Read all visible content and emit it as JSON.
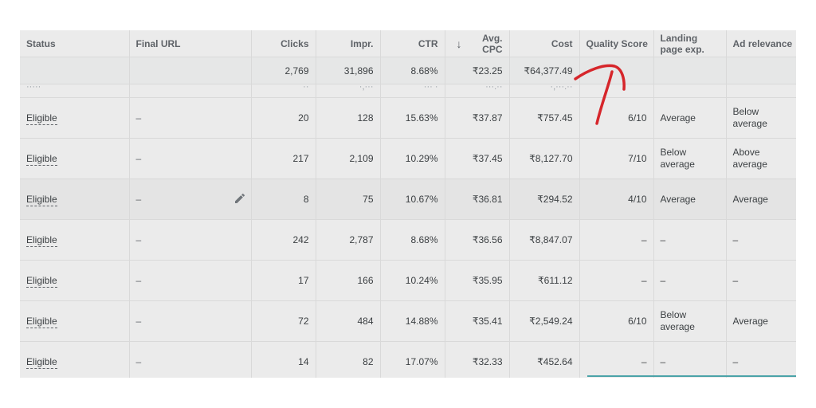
{
  "headers": {
    "status": "Status",
    "final_url": "Final URL",
    "clicks": "Clicks",
    "impr": "Impr.",
    "ctr": "CTR",
    "avg_cpc_line1": "Avg.",
    "avg_cpc_line2": "CPC",
    "cost": "Cost",
    "quality_score": "Quality Score",
    "landing_page": "Landing page exp.",
    "ad_relevance": "Ad relevance"
  },
  "sort": {
    "column": "avg_cpc",
    "direction": "descending",
    "icon": "arrow-down-icon"
  },
  "totals": {
    "clicks": "2,769",
    "impr": "31,896",
    "ctr": "8.68%",
    "avg_cpc": "₹23.25",
    "cost": "₹64,377.49"
  },
  "partial_row": {
    "status": "·····",
    "clicks": "··",
    "impr": "·,···",
    "ctr": "··· ·",
    "avg_cpc": "···.··",
    "cost": "·,···.··"
  },
  "rows": [
    {
      "status": "Eligible",
      "final_url": "–",
      "clicks": "20",
      "impr": "128",
      "ctr": "15.63%",
      "avg_cpc": "₹37.87",
      "cost": "₹757.45",
      "quality_score": "6/10",
      "landing_page": "Average",
      "ad_relevance": "Below average"
    },
    {
      "status": "Eligible",
      "final_url": "–",
      "clicks": "217",
      "impr": "2,109",
      "ctr": "10.29%",
      "avg_cpc": "₹37.45",
      "cost": "₹8,127.70",
      "quality_score": "7/10",
      "landing_page": "Below average",
      "ad_relevance": "Above average"
    },
    {
      "status": "Eligible",
      "final_url": "–",
      "clicks": "8",
      "impr": "75",
      "ctr": "10.67%",
      "avg_cpc": "₹36.81",
      "cost": "₹294.52",
      "quality_score": "4/10",
      "landing_page": "Average",
      "ad_relevance": "Average"
    },
    {
      "status": "Eligible",
      "final_url": "–",
      "clicks": "242",
      "impr": "2,787",
      "ctr": "8.68%",
      "avg_cpc": "₹36.56",
      "cost": "₹8,847.07",
      "quality_score": "–",
      "landing_page": "–",
      "ad_relevance": "–"
    },
    {
      "status": "Eligible",
      "final_url": "–",
      "clicks": "17",
      "impr": "166",
      "ctr": "10.24%",
      "avg_cpc": "₹35.95",
      "cost": "₹611.12",
      "quality_score": "–",
      "landing_page": "–",
      "ad_relevance": "–"
    },
    {
      "status": "Eligible",
      "final_url": "–",
      "clicks": "72",
      "impr": "484",
      "ctr": "14.88%",
      "avg_cpc": "₹35.41",
      "cost": "₹2,549.24",
      "quality_score": "6/10",
      "landing_page": "Below average",
      "ad_relevance": "Average"
    },
    {
      "status": "Eligible",
      "final_url": "–",
      "clicks": "14",
      "impr": "82",
      "ctr": "17.07%",
      "avg_cpc": "₹32.33",
      "cost": "₹452.64",
      "quality_score": "–",
      "landing_page": "–",
      "ad_relevance": "–"
    }
  ],
  "colors": {
    "annotation": "#d6262b",
    "accent": "#4aa3a8",
    "table_bg": "#ebebeb",
    "highlight_row": "#e4e4e4"
  },
  "icons": {
    "edit": "pencil-icon"
  }
}
